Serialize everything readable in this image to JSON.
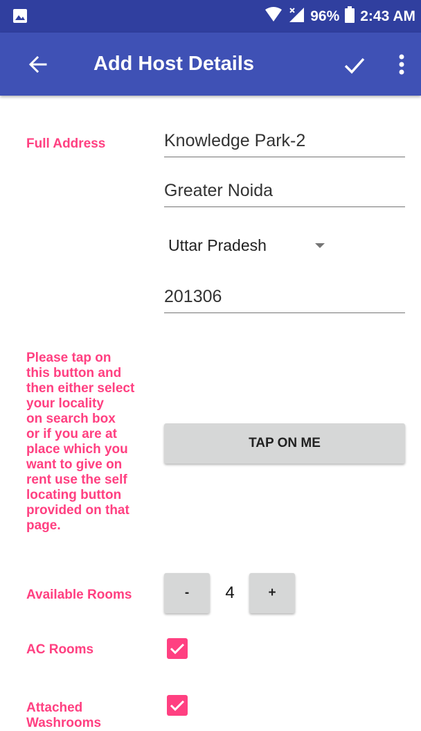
{
  "status_bar": {
    "battery": "96%",
    "time": "2:43 AM"
  },
  "app_bar": {
    "title": "Add Host Details"
  },
  "form": {
    "full_address_label": "Full Address",
    "address_line1": "Knowledge Park-2",
    "city": "Greater Noida",
    "state": "Uttar Pradesh",
    "pincode": "201306",
    "locality_instructions": [
      "Please tap on",
      "this button and",
      "then either select",
      "your locality",
      "on search box",
      "or if you are at",
      "place which you",
      "want to give on",
      "rent use the self",
      "locating button",
      "provided on that",
      "page."
    ],
    "tap_button_label": "TAP ON ME",
    "available_rooms_label": "Available Rooms",
    "decrement_label": "-",
    "rooms_count": "4",
    "increment_label": "+",
    "ac_rooms_label": "AC Rooms",
    "ac_rooms_checked": true,
    "attached_washrooms_label": [
      "Attached",
      "Washrooms"
    ],
    "attached_washrooms_checked": true
  },
  "colors": {
    "primary": "#3f51b5",
    "primary_dark": "#303f9f",
    "accent": "#ff4081"
  },
  "icons": [
    "image-icon",
    "wifi-icon",
    "signal-icon",
    "battery-icon",
    "back-arrow-icon",
    "check-icon",
    "more-vert-icon",
    "dropdown-arrow-icon",
    "checkbox-checked-icon"
  ]
}
